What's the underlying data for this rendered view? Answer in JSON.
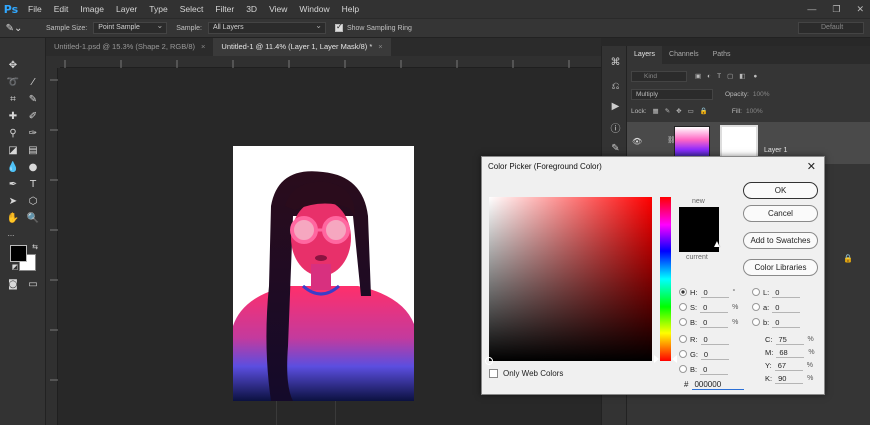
{
  "app": {
    "logo": "Ps"
  },
  "menu": [
    "File",
    "Edit",
    "Image",
    "Layer",
    "Type",
    "Select",
    "Filter",
    "3D",
    "View",
    "Window",
    "Help"
  ],
  "window_controls": {
    "minimize": "—",
    "restore": "❐",
    "close": "✕"
  },
  "options_bar": {
    "sample_size_label": "Sample Size:",
    "sample_size_value": "Point Sample",
    "sample_label": "Sample:",
    "sample_value": "All Layers",
    "show_ring_label": "Show Sampling Ring",
    "workspace": "Default"
  },
  "tabs": [
    {
      "label": "Untitled-1.psd @ 15.3% (Shape 2, RGB/8)",
      "close": "×"
    },
    {
      "label": "Untitled-1 @ 11.4% (Layer 1, Layer Mask/8) *",
      "close": "×"
    }
  ],
  "layers_panel": {
    "tabs": [
      "Layers",
      "Channels",
      "Paths"
    ],
    "filter_placeholder": "Kind",
    "blend_mode": "Multiply",
    "opacity_label": "Opacity:",
    "opacity_value": "100%",
    "lock_label": "Lock:",
    "fill_label": "Fill:",
    "fill_value": "100%",
    "layer_name": "Layer 1"
  },
  "color_picker": {
    "title": "Color Picker (Foreground Color)",
    "new_label": "new",
    "current_label": "current",
    "ok_label": "OK",
    "cancel_label": "Cancel",
    "add_swatches_label": "Add to Swatches",
    "libraries_label": "Color Libraries",
    "only_web_label": "Only Web Colors",
    "hsb": [
      {
        "key": "H:",
        "value": "0",
        "unit": "°"
      },
      {
        "key": "S:",
        "value": "0",
        "unit": "%"
      },
      {
        "key": "B:",
        "value": "0",
        "unit": "%"
      }
    ],
    "rgb": [
      {
        "key": "R:",
        "value": "0"
      },
      {
        "key": "G:",
        "value": "0"
      },
      {
        "key": "B:",
        "value": "0"
      }
    ],
    "lab": [
      {
        "key": "L:",
        "value": "0"
      },
      {
        "key": "a:",
        "value": "0"
      },
      {
        "key": "b:",
        "value": "0"
      }
    ],
    "cmyk": [
      {
        "key": "C:",
        "value": "75",
        "unit": "%"
      },
      {
        "key": "M:",
        "value": "68",
        "unit": "%"
      },
      {
        "key": "Y:",
        "value": "67",
        "unit": "%"
      },
      {
        "key": "K:",
        "value": "90",
        "unit": "%"
      }
    ],
    "hex_label": "#",
    "hex_value": "000000"
  },
  "colors": {
    "accent": "#31a8ff",
    "foreground": "#000000",
    "background": "#ffffff"
  }
}
